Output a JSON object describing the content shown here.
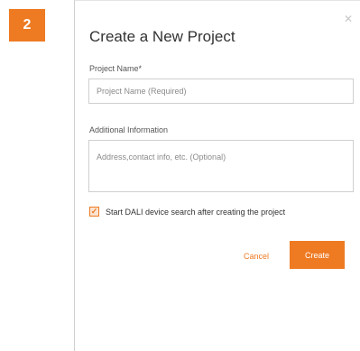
{
  "step": {
    "number": "2"
  },
  "dialog": {
    "title": "Create a New Project",
    "close_icon": "close-icon",
    "project_name": {
      "label": "Project Name*",
      "value": "",
      "placeholder": "Project Name (Required)"
    },
    "additional_info": {
      "label": "Additional Information",
      "value": "",
      "placeholder": "Address,contact info, etc. (Optional)"
    },
    "dali_search": {
      "label": "Start DALI device search after creating the project",
      "checked": true
    },
    "buttons": {
      "cancel_label": "Cancel",
      "create_label": "Create"
    }
  },
  "colors": {
    "accent": "#ee7a22",
    "border": "#cfcfcf",
    "text": "#333333"
  }
}
